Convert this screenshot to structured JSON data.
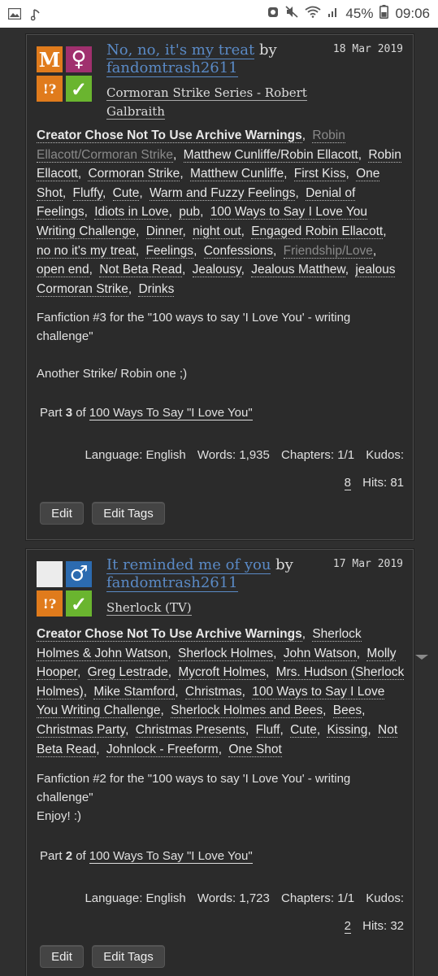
{
  "statusbar": {
    "left_icons": [
      "gallery-icon",
      "music-note-icon"
    ],
    "battery": "45%",
    "time": "09:06"
  },
  "works": [
    {
      "title": "No, no, it's my treat",
      "by": "by",
      "author": "fandomtrash2611",
      "date": "18 Mar 2019",
      "fandom": "Cormoran Strike Series - Robert Galbraith",
      "icons": {
        "rating": "M",
        "category": "♀",
        "warning": "!?",
        "complete": "✓",
        "colors": {
          "rating": "#e07b1c",
          "category": "#a0306e",
          "warning": "#e07b1c",
          "complete": "#6ab52f"
        }
      },
      "tags": [
        {
          "text": "Creator Chose Not To Use Archive Warnings",
          "kind": "warn"
        },
        {
          "text": "Robin Ellacott/Cormoran Strike",
          "kind": "rel"
        },
        {
          "text": "Matthew Cunliffe/Robin Ellacott",
          "kind": "tag"
        },
        {
          "text": "Robin Ellacott",
          "kind": "tag"
        },
        {
          "text": "Cormoran Strike",
          "kind": "tag"
        },
        {
          "text": "Matthew Cunliffe",
          "kind": "tag"
        },
        {
          "text": "First Kiss",
          "kind": "tag"
        },
        {
          "text": "One Shot",
          "kind": "tag"
        },
        {
          "text": "Fluffy",
          "kind": "tag"
        },
        {
          "text": "Cute",
          "kind": "tag"
        },
        {
          "text": "Warm and Fuzzy Feelings",
          "kind": "tag"
        },
        {
          "text": "Denial of Feelings",
          "kind": "tag"
        },
        {
          "text": "Idiots in Love",
          "kind": "tag"
        },
        {
          "text": "pub",
          "kind": "tag"
        },
        {
          "text": "100 Ways to Say I Love You Writing Challenge",
          "kind": "tag"
        },
        {
          "text": "Dinner",
          "kind": "tag"
        },
        {
          "text": "night out",
          "kind": "tag"
        },
        {
          "text": "Engaged Robin Ellacott",
          "kind": "tag"
        },
        {
          "text": "no no it's my treat",
          "kind": "tag"
        },
        {
          "text": "Feelings",
          "kind": "tag"
        },
        {
          "text": "Confessions",
          "kind": "tag"
        },
        {
          "text": "Friendship/Love",
          "kind": "rel"
        },
        {
          "text": "open end",
          "kind": "tag"
        },
        {
          "text": "Not Beta Read",
          "kind": "tag"
        },
        {
          "text": "Jealousy",
          "kind": "tag"
        },
        {
          "text": "Jealous Matthew",
          "kind": "tag"
        },
        {
          "text": "jealous Cormoran Strike",
          "kind": "tag"
        },
        {
          "text": "Drinks",
          "kind": "tag"
        }
      ],
      "summary": [
        "Fanfiction #3 for the \"100 ways to say 'I Love You' - writing challenge\"",
        "",
        "Another Strike/ Robin one ;)"
      ],
      "series_part_prefix": "Part",
      "series_part": "3",
      "series_of": "of",
      "series_name": "100 Ways To Say \"I Love You\"",
      "stats": {
        "language_label": "Language:",
        "language": "English",
        "words_label": "Words:",
        "words": "1,935",
        "chapters_label": "Chapters:",
        "chapters": "1/1",
        "kudos_label": "Kudos:",
        "kudos": "8",
        "hits_label": "Hits:",
        "hits": "81"
      },
      "edit_label": "Edit",
      "edit_tags_label": "Edit Tags"
    },
    {
      "title": "It reminded me of you",
      "by": "by",
      "author": "fandomtrash2611",
      "date": "17 Mar 2019",
      "fandom": "Sherlock (TV)",
      "icons": {
        "rating": "",
        "category": "♂",
        "warning": "!?",
        "complete": "✓",
        "colors": {
          "rating": "#e8e8e8",
          "category": "#2c6bb0",
          "warning": "#e07b1c",
          "complete": "#6ab52f"
        }
      },
      "tags": [
        {
          "text": "Creator Chose Not To Use Archive Warnings",
          "kind": "warn"
        },
        {
          "text": "Sherlock Holmes & John Watson",
          "kind": "tag"
        },
        {
          "text": "Sherlock Holmes",
          "kind": "tag"
        },
        {
          "text": "John Watson",
          "kind": "tag"
        },
        {
          "text": "Molly Hooper",
          "kind": "tag"
        },
        {
          "text": "Greg Lestrade",
          "kind": "tag"
        },
        {
          "text": "Mycroft Holmes",
          "kind": "tag"
        },
        {
          "text": "Mrs. Hudson (Sherlock Holmes)",
          "kind": "tag"
        },
        {
          "text": "Mike Stamford",
          "kind": "tag"
        },
        {
          "text": "Christmas",
          "kind": "tag"
        },
        {
          "text": "100 Ways to Say I Love You Writing Challenge",
          "kind": "tag"
        },
        {
          "text": "Sherlock Holmes and Bees",
          "kind": "tag"
        },
        {
          "text": "Bees",
          "kind": "tag"
        },
        {
          "text": "Christmas Party",
          "kind": "tag"
        },
        {
          "text": "Christmas Presents",
          "kind": "tag"
        },
        {
          "text": "Fluff",
          "kind": "tag"
        },
        {
          "text": "Cute",
          "kind": "tag"
        },
        {
          "text": "Kissing",
          "kind": "tag"
        },
        {
          "text": "Not Beta Read",
          "kind": "tag"
        },
        {
          "text": "Johnlock - Freeform",
          "kind": "tag"
        },
        {
          "text": "One Shot",
          "kind": "tag"
        }
      ],
      "summary": [
        "Fanfiction #2 for the \"100 ways to say 'I Love You' - writing challenge\"",
        "Enjoy! :)"
      ],
      "series_part_prefix": "Part",
      "series_part": "2",
      "series_of": "of",
      "series_name": "100 Ways To Say \"I Love You\"",
      "stats": {
        "language_label": "Language:",
        "language": "English",
        "words_label": "Words:",
        "words": "1,723",
        "chapters_label": "Chapters:",
        "chapters": "1/1",
        "kudos_label": "Kudos:",
        "kudos": "2",
        "hits_label": "Hits:",
        "hits": "32"
      },
      "edit_label": "Edit",
      "edit_tags_label": "Edit Tags"
    }
  ]
}
